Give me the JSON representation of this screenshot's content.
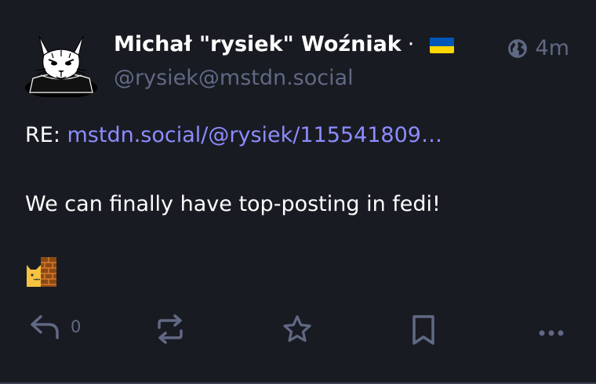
{
  "post": {
    "author": {
      "display_name": "Michał \"rysiek\" Woźniak",
      "separator": "·",
      "flag_icon": "ukraine-flag-icon",
      "handle": "@rysiek@mstdn.social",
      "avatar_icon": "lynx-avatar-icon"
    },
    "visibility_icon": "globe-icon",
    "timestamp": "4m",
    "content": {
      "prefix": "RE: ",
      "link_text": "mstdn.social/@rysiek/115541809…",
      "text": "We can finally have top-posting in fedi!",
      "custom_emoji": "cat-peeking-behind-wall-emoji"
    },
    "actions": {
      "reply_icon": "reply-icon",
      "reply_count": "0",
      "boost_icon": "boost-icon",
      "favourite_icon": "star-icon",
      "bookmark_icon": "bookmark-icon",
      "more_icon": "more-icon"
    }
  },
  "colors": {
    "background": "#191b22",
    "text": "#ffffff",
    "muted": "#606984",
    "link": "#8c8dff",
    "flag_blue": "#0057b7",
    "flag_yellow": "#ffd700"
  }
}
